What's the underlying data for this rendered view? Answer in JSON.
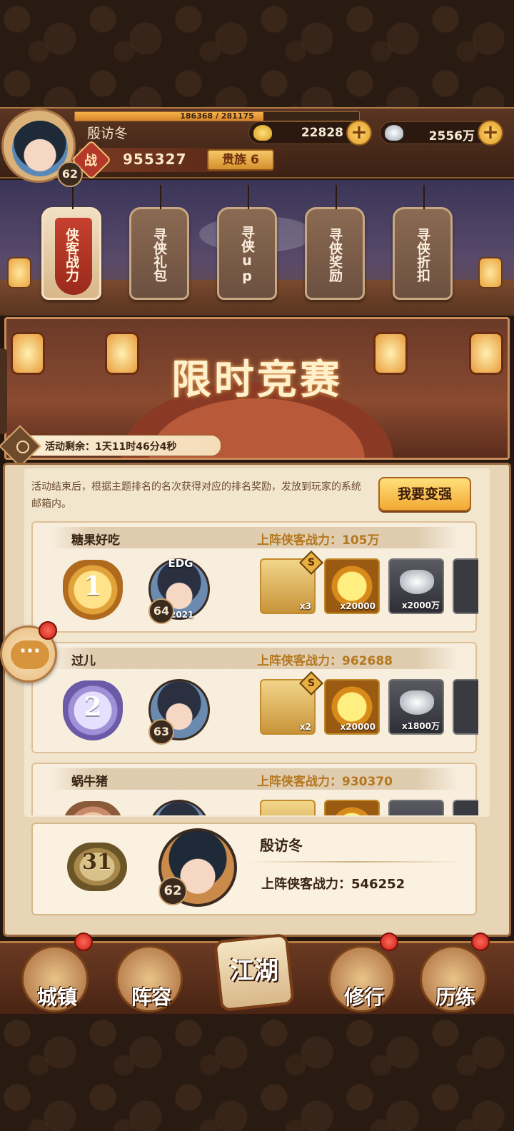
{
  "header": {
    "player_name": "殷访冬",
    "level": "62",
    "exp_text": "186368 / 281175",
    "exp_fraction": 0.663,
    "gold": "22828",
    "silver": "2556万",
    "power_label": "战",
    "power_value": "955327",
    "noble": "贵族 6"
  },
  "tabs": [
    {
      "label": "侠客战力",
      "active": true
    },
    {
      "label": "寻侠礼包",
      "active": false
    },
    {
      "label": "寻侠up",
      "active": false
    },
    {
      "label": "寻侠奖励",
      "active": false
    },
    {
      "label": "寻侠折扣",
      "active": false
    }
  ],
  "banner": {
    "title": "限时竞赛",
    "timer": "活动剩余：1天11时46分4秒"
  },
  "panel": {
    "notice": "活动结束后，根据主题排名的名次获得对应的排名奖励，发放到玩家的系统邮箱内。",
    "strong_button": "我要变强"
  },
  "ranking": [
    {
      "rank": "1",
      "name": "糖果好吃",
      "power": "上阵侠客战力：105万",
      "level": "64",
      "tag": "EDG",
      "year": "2021",
      "rewards": [
        {
          "icon": "hero-card",
          "count": "x3",
          "badge": "S"
        },
        {
          "icon": "gold-coin",
          "count": "x20000"
        },
        {
          "icon": "silver-ingot",
          "count": "x2000万"
        }
      ]
    },
    {
      "rank": "2",
      "name": "过儿",
      "power": "上阵侠客战力：962688",
      "level": "63",
      "rewards": [
        {
          "icon": "hero-card",
          "count": "x2",
          "badge": "S"
        },
        {
          "icon": "gold-coin",
          "count": "x20000"
        },
        {
          "icon": "silver-ingot",
          "count": "x1800万"
        }
      ]
    },
    {
      "rank": "3",
      "name": "蜗牛猪",
      "power": "上阵侠客战力：930370"
    }
  ],
  "self_rank": {
    "rank": "31",
    "name": "殷访冬",
    "level": "62",
    "power": "上阵侠客战力：546252"
  },
  "chat": {
    "icon": "chat-bubble-icon",
    "glyph": "···"
  },
  "nav": [
    {
      "label": "城镇",
      "badge": true
    },
    {
      "label": "阵容",
      "badge": false
    },
    {
      "label": "江湖",
      "badge": false
    },
    {
      "label": "修行",
      "badge": true
    },
    {
      "label": "历练",
      "badge": true
    }
  ],
  "colors": {
    "accent_gold": "#f2a934",
    "power_red": "#b4392a",
    "panel_bg": "#e8d5b6",
    "notification_red": "#c81e14"
  }
}
